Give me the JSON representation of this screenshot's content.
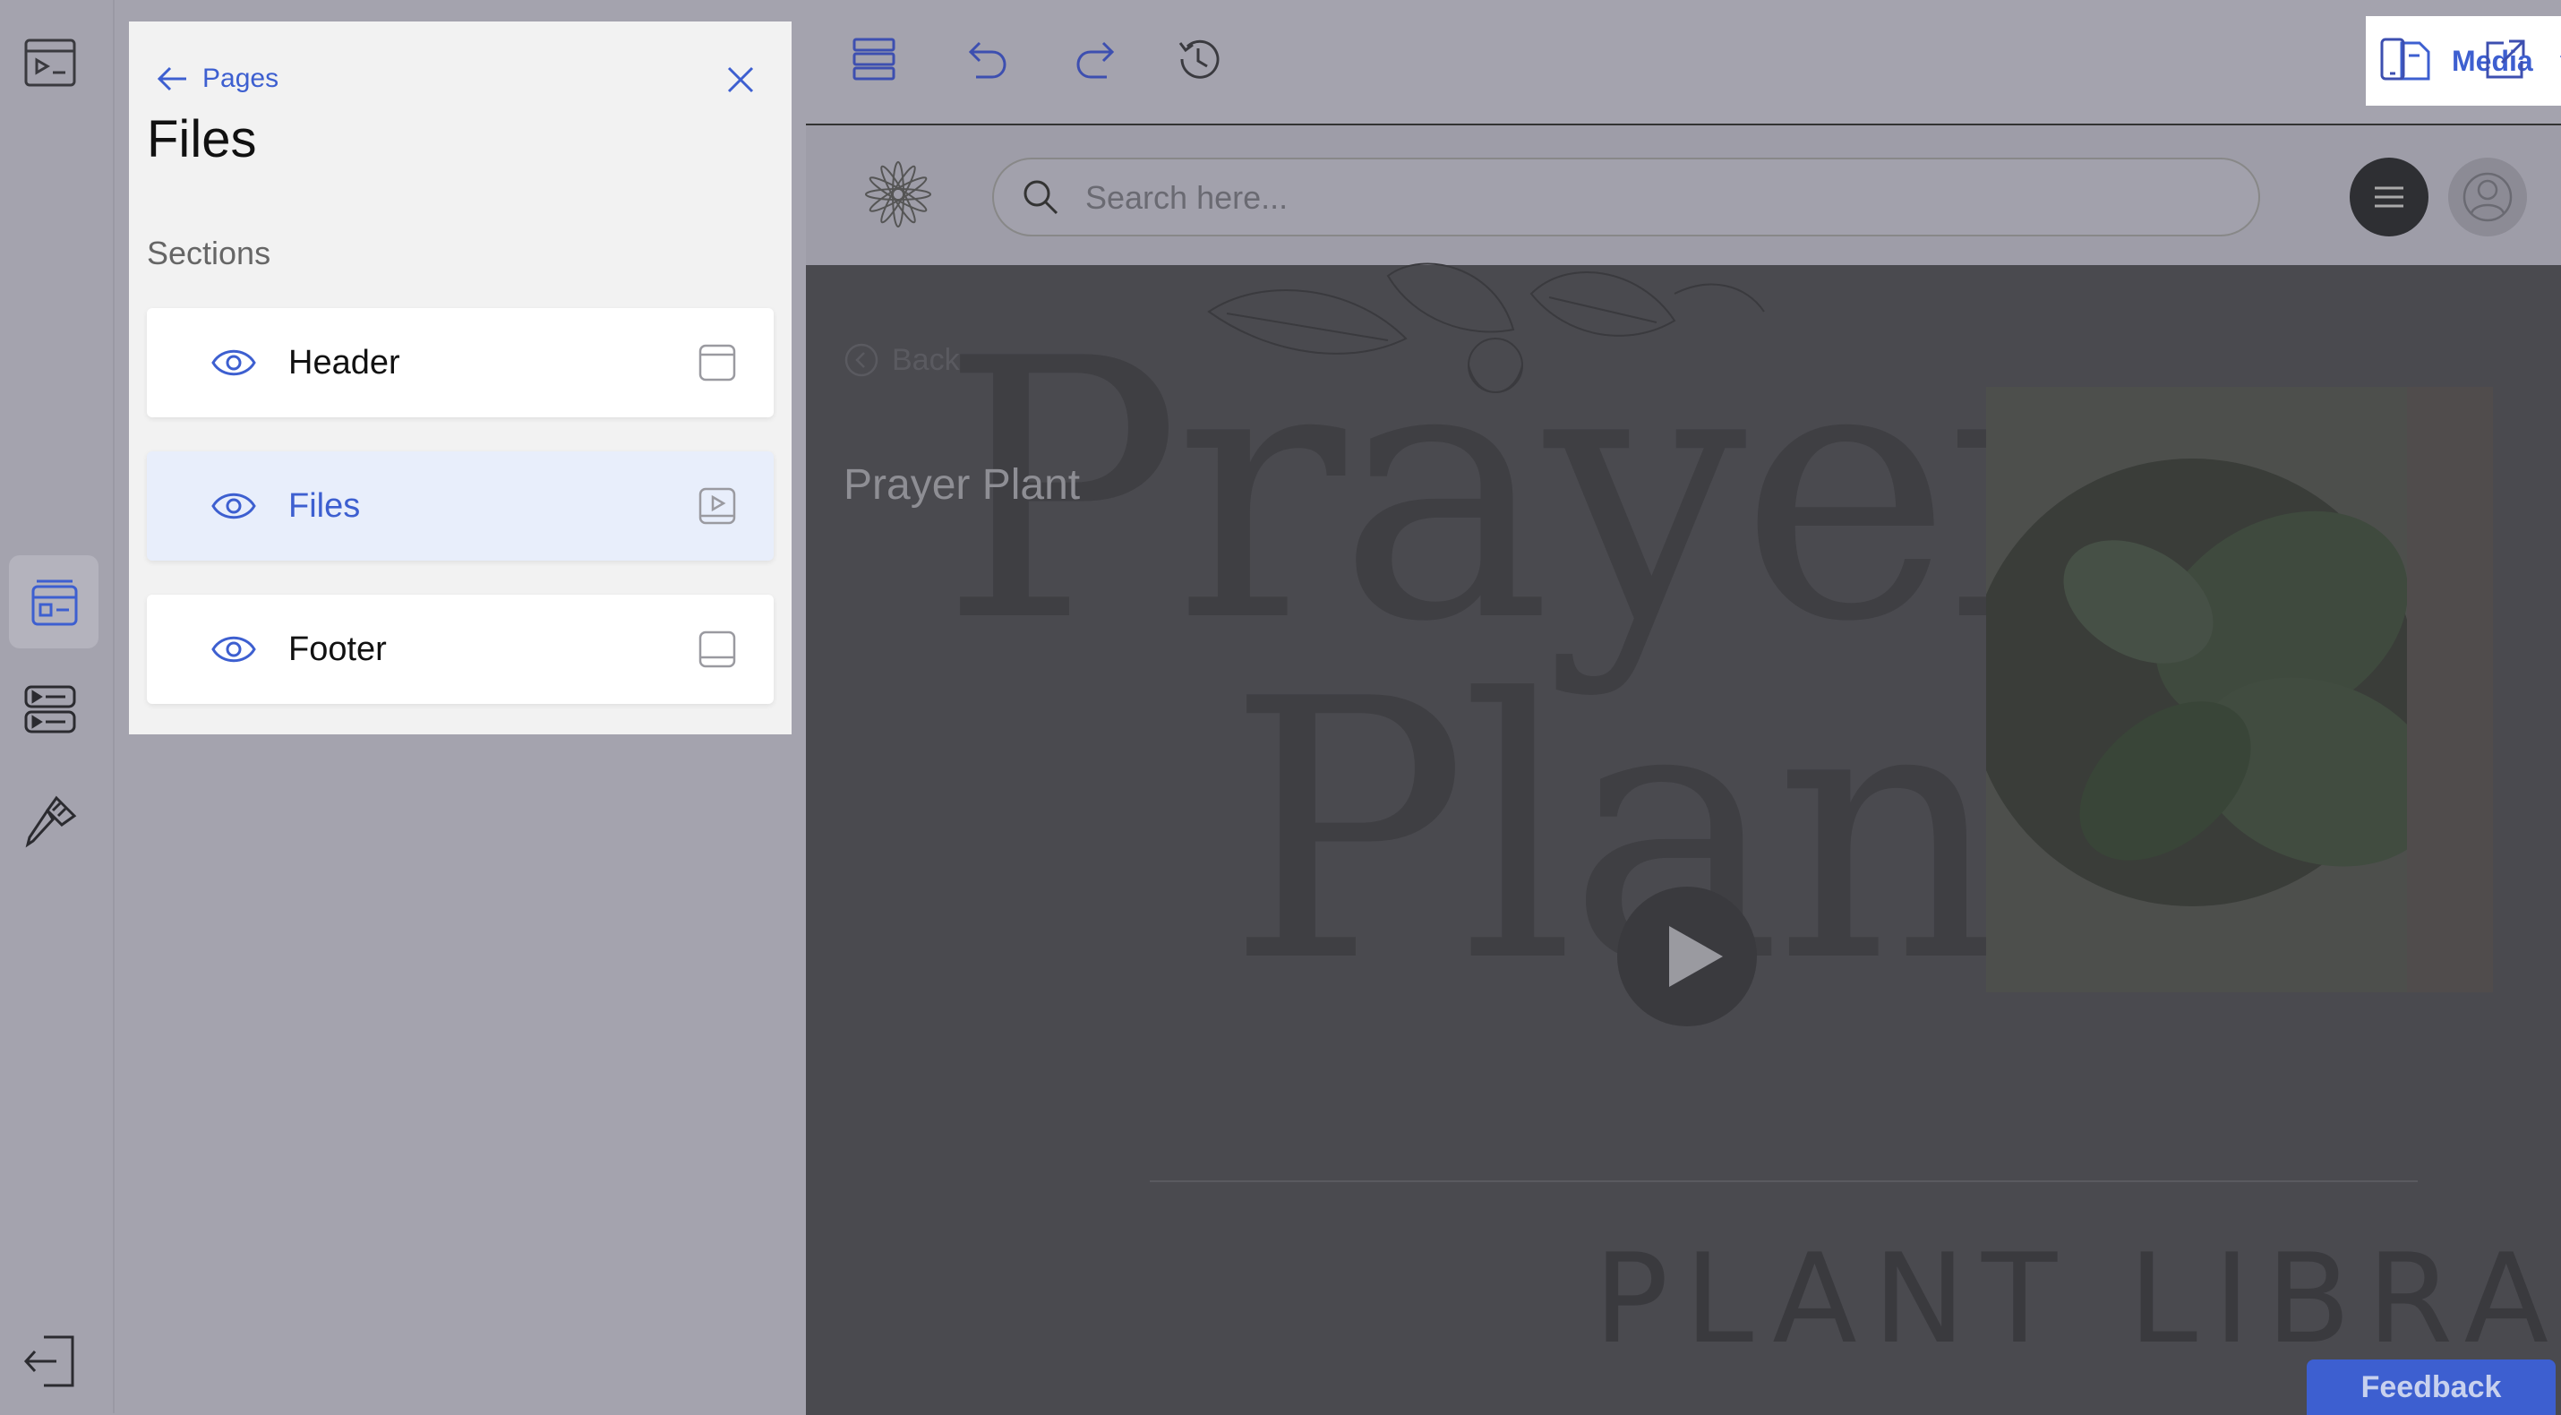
{
  "rail": {
    "items": [
      {
        "name": "preview-mode-icon"
      },
      {
        "name": "pages-layout-icon",
        "active": true
      },
      {
        "name": "sections-list-icon"
      },
      {
        "name": "brush-icon"
      },
      {
        "name": "exit-icon"
      }
    ]
  },
  "panel": {
    "back_label": "Pages",
    "title": "Files",
    "subtitle": "Sections",
    "sections": [
      {
        "label": "Header",
        "active": false,
        "kind_icon": "header-layout-icon"
      },
      {
        "label": "Files",
        "active": true,
        "kind_icon": "media-layout-icon"
      },
      {
        "label": "Footer",
        "active": false,
        "kind_icon": "footer-layout-icon"
      }
    ]
  },
  "toolbar": {
    "media_label": "Media",
    "tools": [
      "layers-icon",
      "undo-icon",
      "redo-icon",
      "history-icon",
      "mobile-preview-icon",
      "open-external-icon"
    ]
  },
  "preview": {
    "search_placeholder": "Search here...",
    "back_label": "Back",
    "big_line1": "Prayer",
    "big_line2": "Plant",
    "page_heading": "Prayer Plant",
    "library_text": "PLANT LIBRARY",
    "feedback_label": "Feedback"
  },
  "colors": {
    "accent": "#3d5fd0",
    "panel_bg": "#f2f2f2",
    "overlay_bg": "#a4a3ae",
    "preview_bg": "#4a4a4f"
  }
}
